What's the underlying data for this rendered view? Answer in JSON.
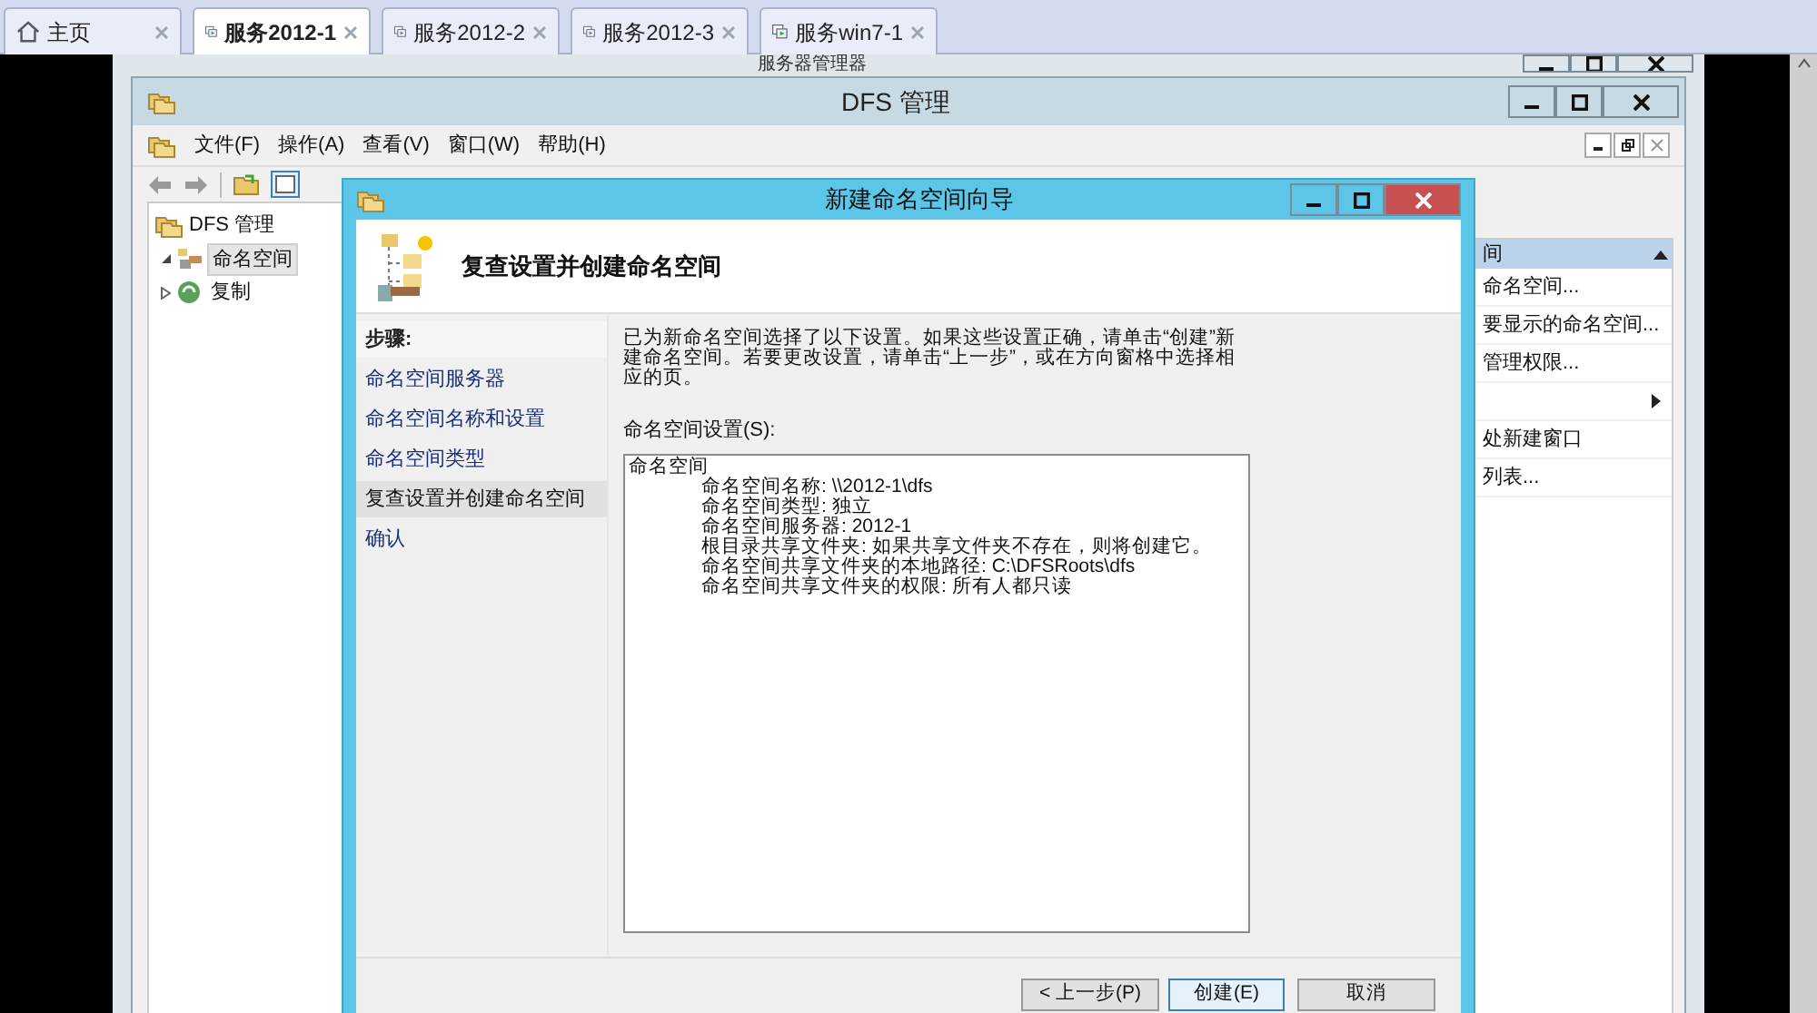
{
  "browser_tabs": [
    {
      "label": "主页",
      "kind": "home",
      "selected": false
    },
    {
      "label": "服务2012-1",
      "kind": "vm",
      "selected": true
    },
    {
      "label": "服务2012-2",
      "kind": "vm",
      "selected": false
    },
    {
      "label": "服务2012-3",
      "kind": "vm",
      "selected": false
    },
    {
      "label": "服务win7-1",
      "kind": "vm",
      "selected": false
    }
  ],
  "server_manager": {
    "title": "服务器管理器"
  },
  "dfs_window": {
    "title": "DFS 管理",
    "menu": [
      "文件(F)",
      "操作(A)",
      "查看(V)",
      "窗口(W)",
      "帮助(H)"
    ],
    "tree": {
      "label": "DFS 管理",
      "children": [
        {
          "label": "命名空间",
          "expanded": true,
          "selected": true
        },
        {
          "label": "复制",
          "expanded": false,
          "selected": false
        }
      ]
    },
    "actions": {
      "header": "间",
      "items": [
        {
          "kind": "item",
          "label": "命名空间..."
        },
        {
          "kind": "item",
          "label": "要显示的命名空间..."
        },
        {
          "kind": "item",
          "label": "管理权限..."
        },
        {
          "kind": "submenu"
        },
        {
          "kind": "item",
          "label": "处新建窗口"
        },
        {
          "kind": "item",
          "label": "列表..."
        }
      ]
    }
  },
  "wizard": {
    "title": "新建命名空间向导",
    "heading": "复查设置并创建命名空间",
    "steps_title": "步骤:",
    "steps": [
      {
        "label": "命名空间服务器",
        "selected": false
      },
      {
        "label": "命名空间名称和设置",
        "selected": false
      },
      {
        "label": "命名空间类型",
        "selected": false
      },
      {
        "label": "复查设置并创建命名空间",
        "selected": true
      },
      {
        "label": "确认",
        "selected": false
      }
    ],
    "description": "已为新命名空间选择了以下设置。如果这些设置正确，请单击“创建”新建命名空间。若要更改设置，请单击“上一步”，或在方向窗格中选择相应的页。",
    "settings_label": "命名空间设置(S):",
    "settings": {
      "title": "命名空间",
      "children": [
        "命名空间名称: \\\\2012-1\\dfs",
        "命名空间类型: 独立",
        "命名空间服务器: 2012-1",
        "根目录共享文件夹: 如果共享文件夹不存在，则将创建它。",
        "命名空间共享文件夹的本地路径: C:\\DFSRoots\\dfs",
        "命名空间共享文件夹的权限: 所有人都只读"
      ]
    },
    "buttons": [
      {
        "kind": "back",
        "label": "< 上一步(P)"
      },
      {
        "kind": "default",
        "label": "创建(E)"
      },
      {
        "kind": "cancel",
        "label": "取消"
      }
    ]
  }
}
